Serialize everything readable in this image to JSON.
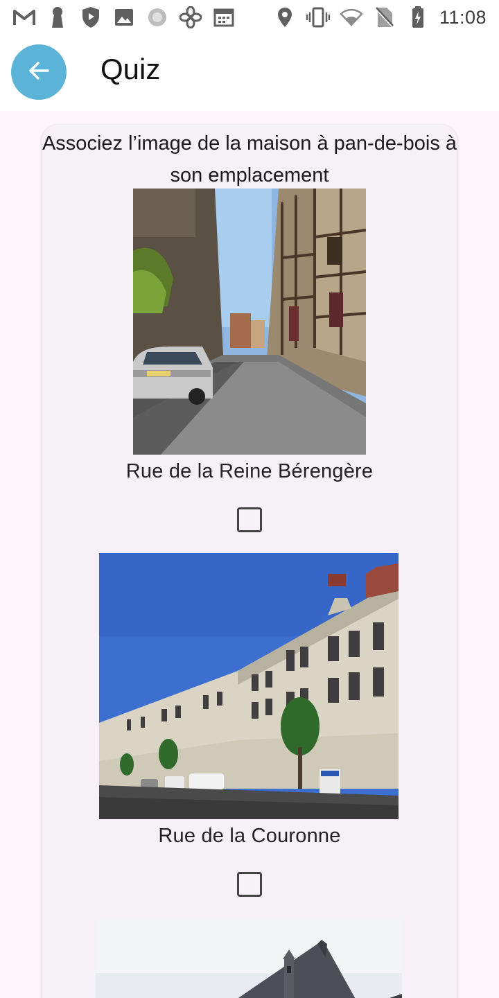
{
  "status_bar": {
    "time": "11:08",
    "left_icons": [
      "gmail-icon",
      "keyhole-icon",
      "shield-play-icon",
      "image-icon",
      "sync-icon",
      "fan-icon",
      "calendar-icon"
    ],
    "right_icons": [
      "location-icon",
      "vibrate-icon",
      "wifi-icon",
      "no-sim-icon",
      "battery-charging-icon"
    ]
  },
  "app_bar": {
    "title": "Quiz",
    "back_icon": "arrow-back-icon",
    "accent": "#5bb4d8"
  },
  "quiz": {
    "question": "Associez l’image de la maison à pan-de-bois à son emplacement",
    "options": [
      {
        "label": "Rue de la Reine Bérengère",
        "checked": false
      },
      {
        "label": "Rue de la Couronne",
        "checked": false
      }
    ]
  },
  "colors": {
    "background": "#fdf7fd",
    "card": "#f6f0f7",
    "text": "#1a1a1a"
  }
}
